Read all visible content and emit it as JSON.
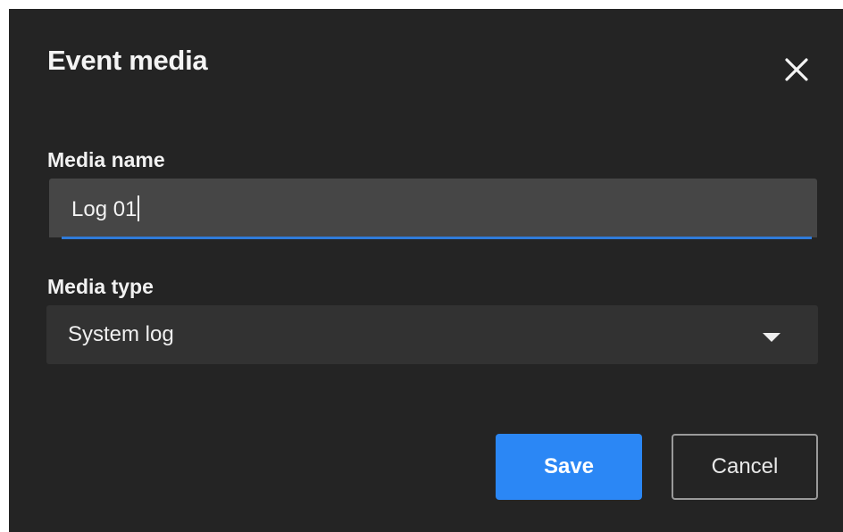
{
  "dialog": {
    "title": "Event media",
    "close_icon": "close-icon"
  },
  "media_name": {
    "label": "Media name",
    "value": "Log 01"
  },
  "media_type": {
    "label": "Media type",
    "selected": "System log",
    "chevron_icon": "chevron-down-icon"
  },
  "actions": {
    "save_label": "Save",
    "cancel_label": "Cancel"
  },
  "colors": {
    "dialog_bg": "#242424",
    "input_bg": "#464646",
    "select_bg": "#323232",
    "accent": "#2b87f5",
    "focus_underline": "#2f7bd9"
  }
}
